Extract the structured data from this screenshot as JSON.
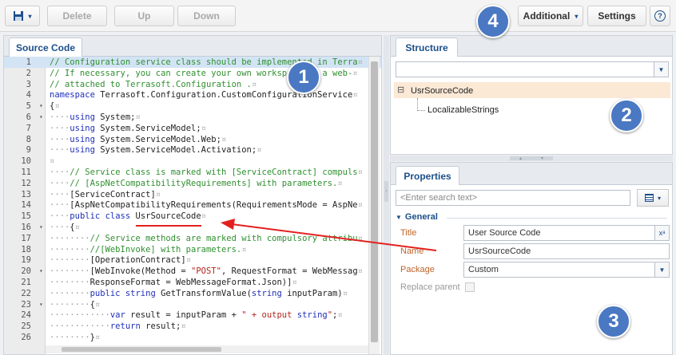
{
  "toolbar": {
    "delete_label": "Delete",
    "up_label": "Up",
    "down_label": "Down",
    "additional_label": "Additional",
    "settings_label": "Settings"
  },
  "source_panel": {
    "tab_label": "Source Code",
    "lines": [
      {
        "n": "1",
        "fold": "",
        "t": "// Configuration service class should be implemented in Terra"
      },
      {
        "n": "2",
        "fold": "",
        "t": "// If necessary, you can create your own workspace or a web-"
      },
      {
        "n": "3",
        "fold": "",
        "t": "// attached to Terrasoft.Configuration ."
      },
      {
        "n": "4",
        "fold": "",
        "t": "namespace Terrasoft.Configuration.CustomConfigurationService"
      },
      {
        "n": "5",
        "fold": "▾",
        "t": "{"
      },
      {
        "n": "6",
        "fold": "▾",
        "t": "    using System;"
      },
      {
        "n": "7",
        "fold": "",
        "t": "    using System.ServiceModel;"
      },
      {
        "n": "8",
        "fold": "",
        "t": "    using System.ServiceModel.Web;"
      },
      {
        "n": "9",
        "fold": "",
        "t": "    using System.ServiceModel.Activation;"
      },
      {
        "n": "10",
        "fold": "",
        "t": ""
      },
      {
        "n": "11",
        "fold": "",
        "t": "    // Service class is marked with [ServiceContract] compuls"
      },
      {
        "n": "12",
        "fold": "",
        "t": "    // [AspNetCompatibilityRequirements] with parameters."
      },
      {
        "n": "13",
        "fold": "",
        "t": "    [ServiceContract]"
      },
      {
        "n": "14",
        "fold": "",
        "t": "    [AspNetCompatibilityRequirements(RequirementsMode = AspNe"
      },
      {
        "n": "15",
        "fold": "",
        "t": "    public class UsrSourceCode"
      },
      {
        "n": "16",
        "fold": "▾",
        "t": "    {"
      },
      {
        "n": "17",
        "fold": "",
        "t": "        // Service methods are marked with compulsory attribu"
      },
      {
        "n": "18",
        "fold": "",
        "t": "        //[WebInvoke] with parameters."
      },
      {
        "n": "19",
        "fold": "",
        "t": "        [OperationContract]"
      },
      {
        "n": "20",
        "fold": "▾",
        "t": "        [WebInvoke(Method = \"POST\", RequestFormat = WebMessag"
      },
      {
        "n": "21",
        "fold": "",
        "t": "        ResponseFormat = WebMessageFormat.Json)]"
      },
      {
        "n": "22",
        "fold": "",
        "t": "        public string GetTransformValue(string inputParam)"
      },
      {
        "n": "23",
        "fold": "▾",
        "t": "        {"
      },
      {
        "n": "24",
        "fold": "",
        "t": "            var result = inputParam + \" + output string\";"
      },
      {
        "n": "25",
        "fold": "",
        "t": "            return result;"
      },
      {
        "n": "26",
        "fold": "",
        "t": "        }"
      }
    ]
  },
  "structure_panel": {
    "tab_label": "Structure",
    "tree": {
      "root": "UsrSourceCode",
      "child": "LocalizableStrings",
      "toggle": "⊟"
    }
  },
  "properties_panel": {
    "tab_label": "Properties",
    "search_placeholder": "<Enter search text>",
    "section_title": "General",
    "fields": {
      "title_label": "Title",
      "title_value": "User Source Code",
      "name_label": "Name",
      "name_value": "UsrSourceCode",
      "package_label": "Package",
      "package_value": "Custom",
      "replace_label": "Replace parent"
    }
  },
  "badges": {
    "b1": "1",
    "b2": "2",
    "b3": "3",
    "b4": "4"
  },
  "colors": {
    "accent": "#4a78c2",
    "arrow": "#e2201f",
    "label": "#c0632a"
  }
}
